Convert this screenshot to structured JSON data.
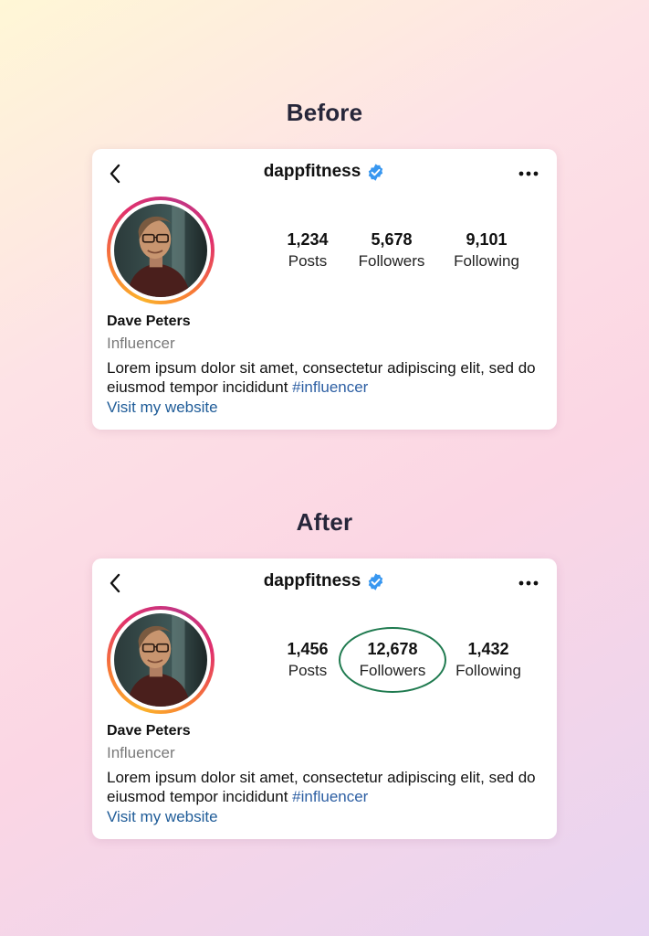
{
  "before": {
    "title": "Before",
    "profile": {
      "username": "dappfitness",
      "name": "Dave Peters",
      "category": "Influencer",
      "bio_text": "Lorem ipsum dolor sit amet, consectetur adipiscing elit, sed do eiusmod tempor incididunt ",
      "bio_hashtag": "#influencer",
      "website_label": "Visit my website",
      "stats": {
        "posts": "1,234",
        "posts_label": "Posts",
        "followers": "5,678",
        "followers_label": "Followers",
        "following": "9,101",
        "following_label": "Following"
      }
    }
  },
  "after": {
    "title": "After",
    "profile": {
      "username": "dappfitness",
      "name": "Dave Peters",
      "category": "Influencer",
      "bio_text": "Lorem ipsum dolor sit amet, consectetur adipiscing elit, sed do eiusmod tempor incididunt ",
      "bio_hashtag": "#influencer",
      "website_label": "Visit my website",
      "stats": {
        "posts": "1,456",
        "posts_label": "Posts",
        "followers": "12,678",
        "followers_label": "Followers",
        "following": "1,432",
        "following_label": "Following"
      }
    }
  },
  "colors": {
    "verified": "#3897f0",
    "link": "#1f5c98",
    "hashtag": "#2d5fa3",
    "highlight": "#1f7a4f"
  },
  "icons": [
    "back-arrow-icon",
    "verified-badge-icon",
    "more-options-icon"
  ]
}
